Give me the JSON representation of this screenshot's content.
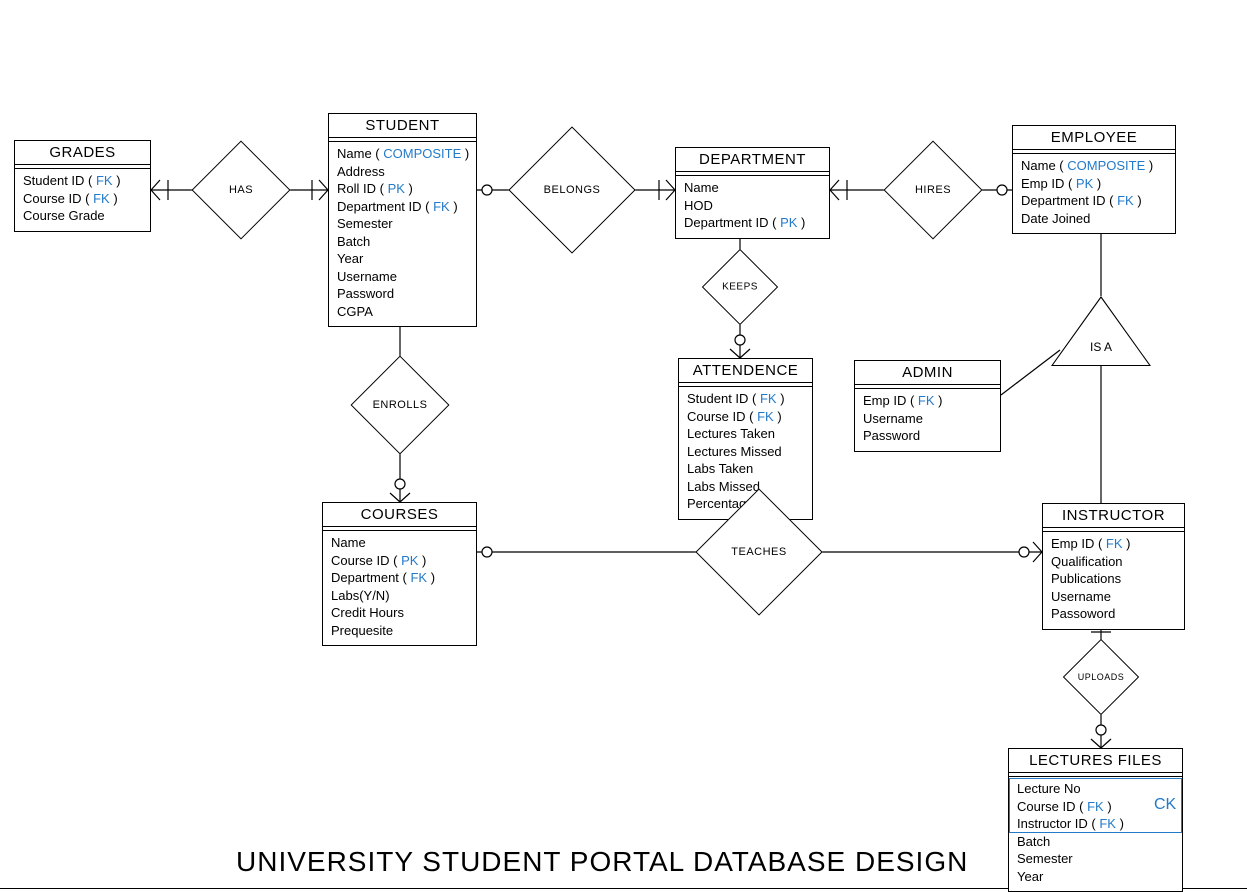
{
  "page_title": "UNIVERSITY STUDENT PORTAL DATABASE DESIGN",
  "keys": {
    "pk": "PK",
    "fk": "FK",
    "composite": "COMPOSITE",
    "ck": "CK"
  },
  "entities": {
    "grades": {
      "title": "GRADES",
      "attrs": [
        {
          "label": "Student ID",
          "key": "fk"
        },
        {
          "label": "Course ID",
          "key": "fk"
        },
        {
          "label": "Course Grade"
        }
      ]
    },
    "student": {
      "title": "STUDENT",
      "attrs": [
        {
          "label": "Name",
          "key": "composite"
        },
        {
          "label": "Address"
        },
        {
          "label": "Roll ID",
          "key": "pk"
        },
        {
          "label": "Department ID",
          "key": "fk"
        },
        {
          "label": "Semester"
        },
        {
          "label": "Batch"
        },
        {
          "label": "Year"
        },
        {
          "label": "Username"
        },
        {
          "label": "Password"
        },
        {
          "label": "CGPA"
        }
      ]
    },
    "department": {
      "title": "DEPARTMENT",
      "attrs": [
        {
          "label": "Name"
        },
        {
          "label": "HOD"
        },
        {
          "label": "Department ID",
          "key": "pk"
        }
      ]
    },
    "employee": {
      "title": "EMPLOYEE",
      "attrs": [
        {
          "label": "Name",
          "key": "composite"
        },
        {
          "label": "Emp ID",
          "key": "pk"
        },
        {
          "label": "Department ID",
          "key": "fk"
        },
        {
          "label": "Date Joined"
        }
      ]
    },
    "attendence": {
      "title": "ATTENDENCE",
      "attrs": [
        {
          "label": "Student ID",
          "key": "fk"
        },
        {
          "label": "Course ID",
          "key": "fk"
        },
        {
          "label": "Lectures Taken"
        },
        {
          "label": "Lectures Missed"
        },
        {
          "label": "Labs Taken"
        },
        {
          "label": "Labs Missed"
        },
        {
          "label": "Percentage"
        }
      ]
    },
    "admin": {
      "title": "ADMIN",
      "attrs": [
        {
          "label": "Emp ID",
          "key": "fk"
        },
        {
          "label": "Username"
        },
        {
          "label": "Password"
        }
      ]
    },
    "courses": {
      "title": "COURSES",
      "attrs": [
        {
          "label": "Name"
        },
        {
          "label": "Course ID",
          "key": "pk"
        },
        {
          "label": "Department",
          "key": "fk"
        },
        {
          "label": "Labs(Y/N)"
        },
        {
          "label": "Credit Hours"
        },
        {
          "label": "Prequesite"
        }
      ]
    },
    "instructor": {
      "title": "INSTRUCTOR",
      "attrs": [
        {
          "label": "Emp ID",
          "key": "fk"
        },
        {
          "label": "Qualification"
        },
        {
          "label": "Publications"
        },
        {
          "label": "Username"
        },
        {
          "label": "Passoword"
        }
      ]
    },
    "lectures_files": {
      "title": "LECTURES FILES",
      "attrs": [
        {
          "label": "Lecture No"
        },
        {
          "label": "Course ID",
          "key": "fk"
        },
        {
          "label": "Instructor ID",
          "key": "fk"
        },
        {
          "label": "Batch"
        },
        {
          "label": "Semester"
        },
        {
          "label": "Year"
        }
      ]
    }
  },
  "relationships": {
    "has": "HAS",
    "belongs": "BELONGS",
    "hires": "HIRES",
    "keeps": "KEEPS",
    "enrolls": "ENROLLS",
    "teaches": "TEACHES",
    "uploads": "UPLOADS",
    "is_a": "IS A"
  }
}
